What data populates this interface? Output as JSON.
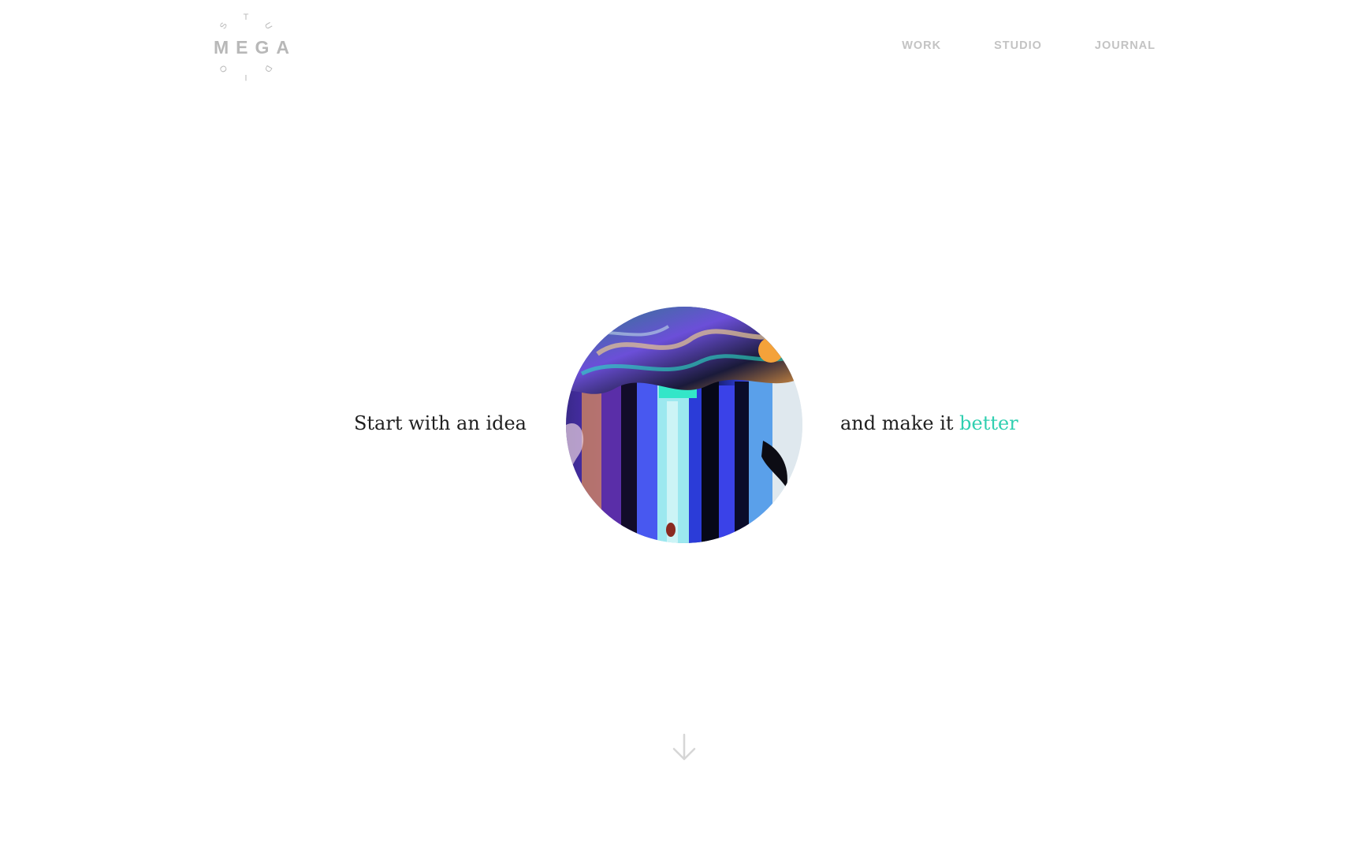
{
  "logo": {
    "word": "MEGA",
    "ring_letters": [
      "T",
      "U",
      "D",
      "I",
      "O",
      "S"
    ]
  },
  "nav": {
    "items": [
      {
        "label": "WORK"
      },
      {
        "label": "STUDIO"
      },
      {
        "label": "JOURNAL"
      }
    ]
  },
  "hero": {
    "left_text": "Start with an idea",
    "right_text": "and make it",
    "accent_text": "better"
  },
  "colors": {
    "background": "#ffffff",
    "nav_text": "#c3c3c3",
    "body_text": "#1f1f1f",
    "accent": "#2fcfb0",
    "logo": "#b8b8b8"
  },
  "icons": {
    "scroll": "arrow-down-icon"
  }
}
